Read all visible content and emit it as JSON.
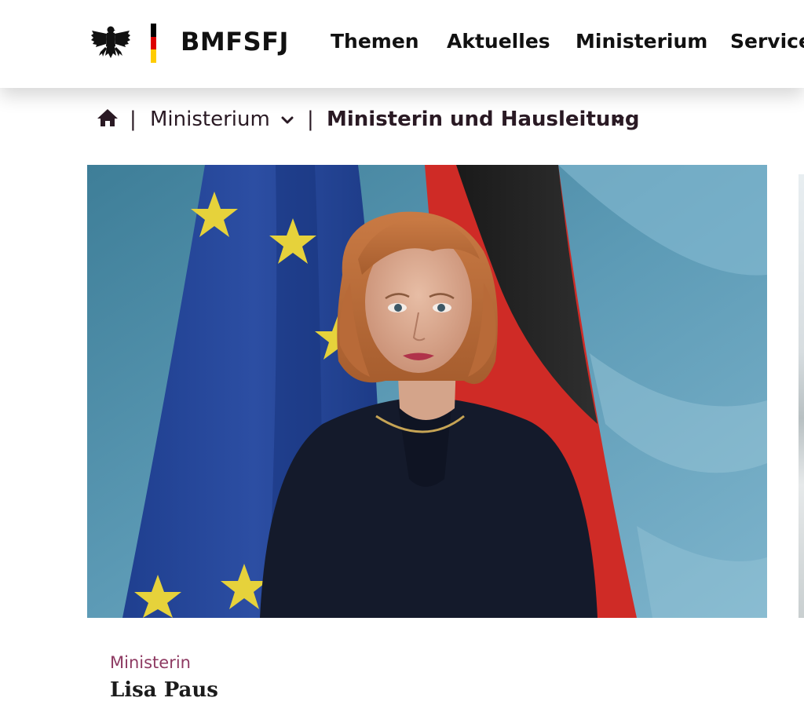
{
  "header": {
    "brand": "BMFSFJ",
    "logo_icon": "federal-eagle-icon",
    "flag_colors": [
      "#000000",
      "#dd0000",
      "#ffcc00"
    ],
    "nav": [
      {
        "label": "Themen"
      },
      {
        "label": "Aktuelles"
      },
      {
        "label": "Ministerium"
      },
      {
        "label": "Service"
      }
    ]
  },
  "breadcrumb": {
    "home_icon": "home-icon",
    "separator": "|",
    "items": [
      {
        "label": "Ministerium",
        "icon": "chevron-down-icon"
      },
      {
        "label": "Ministerin und Hausleitung",
        "icon": "chevron-down-icon"
      }
    ]
  },
  "hero": {
    "image": "portrait-photo"
  },
  "caption": {
    "role": "Ministerin",
    "name": "Lisa Paus"
  },
  "colors": {
    "accent": "#8e3a62",
    "text": "#1b1b1b"
  }
}
